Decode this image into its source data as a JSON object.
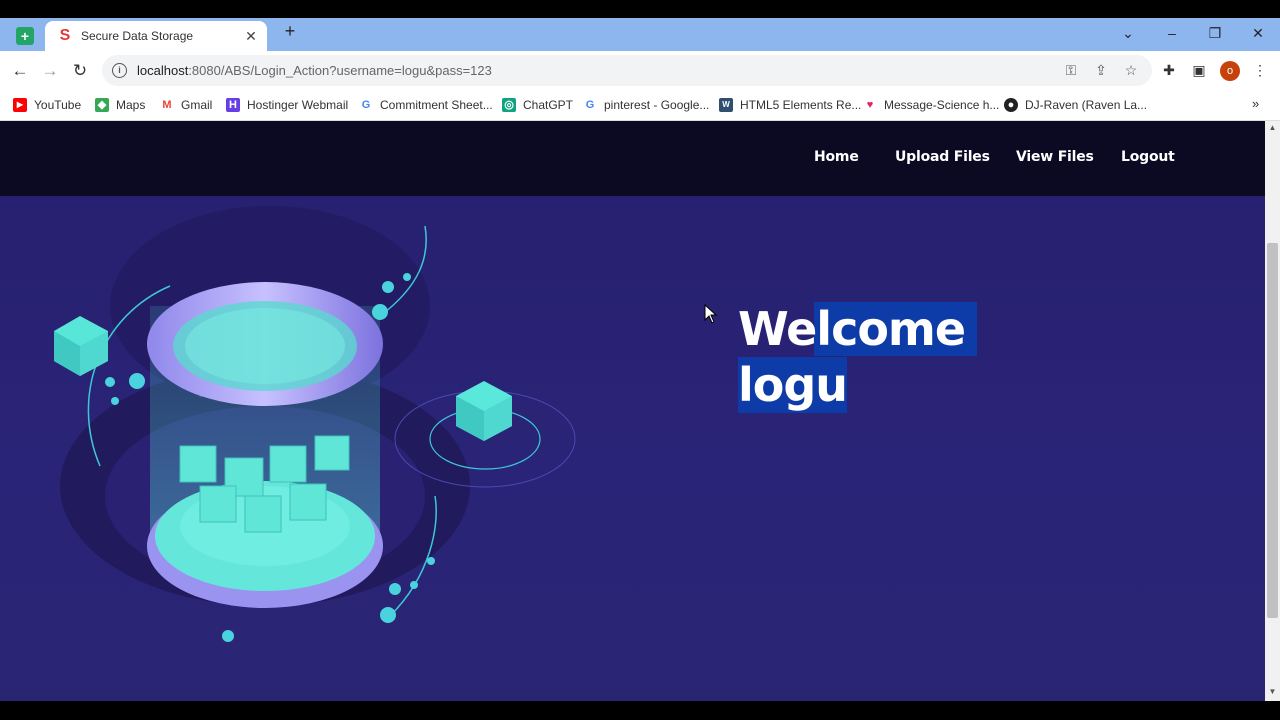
{
  "browser": {
    "tab": {
      "title": "Secure Data Storage",
      "favicon": "S",
      "close": "✕"
    },
    "pinned_tab_icon": "sheets-icon",
    "new_tab": "+",
    "window": {
      "dropdown": "⌄",
      "minimize": "–",
      "restore": "❐",
      "close": "✕"
    },
    "address": {
      "host": "localhost",
      "rest": ":8080/ABS/Login_Action?username=logu&pass=123"
    },
    "bookmarks": [
      {
        "label": "YouTube",
        "icon": "youtube-icon",
        "color": "#ff0000",
        "glyph": "▶"
      },
      {
        "label": "Maps",
        "icon": "maps-icon",
        "color": "#34a853",
        "glyph": "◆"
      },
      {
        "label": "Gmail",
        "icon": "gmail-icon",
        "color": "#ea4335",
        "glyph": "M"
      },
      {
        "label": "Hostinger Webmail",
        "icon": "hostinger-icon",
        "color": "#673de6",
        "glyph": "H"
      },
      {
        "label": "Commitment Sheet...",
        "icon": "google-icon",
        "color": "#4285f4",
        "glyph": "G"
      },
      {
        "label": "ChatGPT",
        "icon": "chatgpt-icon",
        "color": "#10a37f",
        "glyph": "◎"
      },
      {
        "label": "pinterest - Google...",
        "icon": "google-icon",
        "color": "#4285f4",
        "glyph": "G"
      },
      {
        "label": "HTML5 Elements Re...",
        "icon": "html5-icon",
        "color": "#2f4f6f",
        "glyph": "W"
      },
      {
        "label": "Message-Science h...",
        "icon": "heart-icon",
        "color": "#e91e63",
        "glyph": "♥"
      },
      {
        "label": "DJ-Raven (Raven La...",
        "icon": "github-icon",
        "color": "#222222",
        "glyph": "●"
      }
    ],
    "bookmarks_more": "»",
    "avatar_letter": "o"
  },
  "site": {
    "nav": {
      "home": "Home",
      "upload": "Upload Files",
      "view": "View Files",
      "logout": "Logout"
    },
    "welcome_line1": "Welcome",
    "welcome_line2": "logu"
  }
}
